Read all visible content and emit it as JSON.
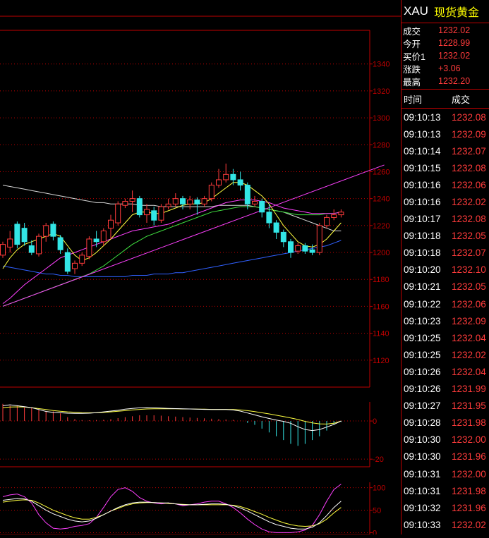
{
  "header": {
    "symbol": "XAU",
    "name": "现货黄金"
  },
  "quote": [
    {
      "label": "成交",
      "value": "1232.02"
    },
    {
      "label": "今开",
      "value": "1228.99"
    },
    {
      "label": "买价1",
      "value": "1232.02"
    },
    {
      "label": "涨跌",
      "value": "+3.06"
    },
    {
      "label": "最高",
      "value": "1232.20"
    }
  ],
  "ticks_header": {
    "time": "时间",
    "price": "成交"
  },
  "ticks": [
    {
      "time": "09:10:13",
      "price": "1232.08"
    },
    {
      "time": "09:10:13",
      "price": "1232.09"
    },
    {
      "time": "09:10:14",
      "price": "1232.07"
    },
    {
      "time": "09:10:15",
      "price": "1232.08"
    },
    {
      "time": "09:10:16",
      "price": "1232.06"
    },
    {
      "time": "09:10:16",
      "price": "1232.02"
    },
    {
      "time": "09:10:17",
      "price": "1232.08"
    },
    {
      "time": "09:10:18",
      "price": "1232.05"
    },
    {
      "time": "09:10:18",
      "price": "1232.07"
    },
    {
      "time": "09:10:20",
      "price": "1232.10"
    },
    {
      "time": "09:10:21",
      "price": "1232.05"
    },
    {
      "time": "09:10:22",
      "price": "1232.06"
    },
    {
      "time": "09:10:23",
      "price": "1232.09"
    },
    {
      "time": "09:10:25",
      "price": "1232.04"
    },
    {
      "time": "09:10:25",
      "price": "1232.02"
    },
    {
      "time": "09:10:26",
      "price": "1232.04"
    },
    {
      "time": "09:10:26",
      "price": "1231.99"
    },
    {
      "time": "09:10:27",
      "price": "1231.95"
    },
    {
      "time": "09:10:28",
      "price": "1231.98"
    },
    {
      "time": "09:10:30",
      "price": "1232.00"
    },
    {
      "time": "09:10:30",
      "price": "1231.96"
    },
    {
      "time": "09:10:31",
      "price": "1232.00"
    },
    {
      "time": "09:10:31",
      "price": "1231.98"
    },
    {
      "time": "09:10:32",
      "price": "1231.96"
    },
    {
      "time": "09:10:33",
      "price": "1232.02"
    }
  ],
  "colors": {
    "up": "#ff3b3b",
    "down": "#33e6e6",
    "grid": "#c00000",
    "ma_white": "#d8d8d8",
    "ma_yellow": "#ffff40",
    "ma_magenta": "#ff40ff",
    "ma_green": "#40e040",
    "ma_blue": "#3060ff"
  },
  "chart_data": [
    {
      "type": "candlestick",
      "ylim": [
        1100,
        1365
      ],
      "yticks": [
        1120,
        1140,
        1160,
        1180,
        1200,
        1220,
        1240,
        1260,
        1280,
        1300,
        1320,
        1340
      ],
      "candles": [
        [
          1198,
          1206,
          1196,
          1208
        ],
        [
          1204,
          1210,
          1200,
          1216
        ],
        [
          1221,
          1206,
          1203,
          1223
        ],
        [
          1218,
          1208,
          1205,
          1222
        ],
        [
          1205,
          1200,
          1198,
          1209
        ],
        [
          1199,
          1212,
          1197,
          1214
        ],
        [
          1212,
          1220,
          1208,
          1222
        ],
        [
          1221,
          1212,
          1209,
          1223
        ],
        [
          1211,
          1202,
          1199,
          1213
        ],
        [
          1200,
          1186,
          1184,
          1203
        ],
        [
          1188,
          1192,
          1184,
          1194
        ],
        [
          1192,
          1198,
          1190,
          1200
        ],
        [
          1197,
          1210,
          1195,
          1212
        ],
        [
          1210,
          1208,
          1204,
          1216
        ],
        [
          1208,
          1216,
          1205,
          1218
        ],
        [
          1218,
          1224,
          1210,
          1228
        ],
        [
          1222,
          1236,
          1220,
          1238
        ],
        [
          1235,
          1238,
          1233,
          1240
        ],
        [
          1238,
          1240,
          1230,
          1246
        ],
        [
          1240,
          1228,
          1226,
          1242
        ],
        [
          1228,
          1232,
          1222,
          1236
        ],
        [
          1231,
          1224,
          1220,
          1234
        ],
        [
          1224,
          1234,
          1222,
          1236
        ],
        [
          1234,
          1236,
          1232,
          1240
        ],
        [
          1236,
          1240,
          1234,
          1244
        ],
        [
          1240,
          1236,
          1232,
          1242
        ],
        [
          1236,
          1239,
          1232,
          1242
        ],
        [
          1239,
          1236,
          1228,
          1241
        ],
        [
          1236,
          1240,
          1234,
          1242
        ],
        [
          1240,
          1250,
          1238,
          1252
        ],
        [
          1250,
          1254,
          1248,
          1262
        ],
        [
          1254,
          1258,
          1252,
          1266
        ],
        [
          1258,
          1254,
          1250,
          1262
        ],
        [
          1254,
          1250,
          1246,
          1260
        ],
        [
          1250,
          1236,
          1232,
          1252
        ],
        [
          1236,
          1238,
          1234,
          1242
        ],
        [
          1238,
          1230,
          1226,
          1240
        ],
        [
          1230,
          1222,
          1218,
          1236
        ],
        [
          1222,
          1215,
          1210,
          1224
        ],
        [
          1215,
          1208,
          1204,
          1217
        ],
        [
          1208,
          1200,
          1196,
          1210
        ],
        [
          1201,
          1205,
          1199,
          1207
        ],
        [
          1205,
          1201,
          1199,
          1207
        ],
        [
          1202,
          1200,
          1198,
          1206
        ],
        [
          1200,
          1220,
          1198,
          1222
        ],
        [
          1220,
          1226,
          1218,
          1228
        ],
        [
          1226,
          1228,
          1224,
          1232
        ],
        [
          1228,
          1230,
          1226,
          1232
        ]
      ],
      "ma_white": [
        1250,
        1249,
        1248,
        1247,
        1246,
        1245,
        1244,
        1243,
        1242,
        1241,
        1240,
        1239,
        1238,
        1237,
        1237,
        1236,
        1236,
        1236,
        1236,
        1235,
        1235,
        1235,
        1234,
        1234,
        1234,
        1234,
        1234,
        1234,
        1234,
        1234,
        1235,
        1235,
        1235,
        1235,
        1235,
        1234,
        1233,
        1232,
        1231,
        1230,
        1228,
        1226,
        1224,
        1222,
        1220,
        1218,
        1216,
        1216
      ],
      "ma_yellow": [
        1188,
        1196,
        1202,
        1206,
        1208,
        1210,
        1212,
        1214,
        1212,
        1205,
        1198,
        1194,
        1196,
        1200,
        1205,
        1210,
        1216,
        1222,
        1228,
        1230,
        1230,
        1229,
        1229,
        1231,
        1233,
        1235,
        1236,
        1236,
        1237,
        1240,
        1244,
        1248,
        1252,
        1252,
        1250,
        1246,
        1242,
        1236,
        1228,
        1220,
        1214,
        1208,
        1205,
        1204,
        1206,
        1210,
        1216,
        1222
      ],
      "ma_magenta": [
        1162,
        1166,
        1171,
        1176,
        1180,
        1184,
        1188,
        1192,
        1196,
        1198,
        1200,
        1202,
        1204,
        1206,
        1208,
        1210,
        1212,
        1214,
        1216,
        1217,
        1218,
        1219,
        1220,
        1221,
        1223,
        1225,
        1227,
        1229,
        1231,
        1233,
        1235,
        1237,
        1238,
        1239,
        1239,
        1239,
        1238,
        1237,
        1235,
        1233,
        1232,
        1231,
        1230,
        1229,
        1229,
        1229,
        1229,
        1230
      ],
      "ma_green": [
        1160,
        1162,
        1164,
        1166,
        1168,
        1170,
        1172,
        1174,
        1176,
        1178,
        1180,
        1182,
        1184,
        1187,
        1190,
        1194,
        1198,
        1202,
        1206,
        1209,
        1212,
        1214,
        1216,
        1218,
        1220,
        1222,
        1224,
        1226,
        1228,
        1230,
        1231,
        1232,
        1233,
        1234,
        1234,
        1234,
        1233,
        1232,
        1231,
        1230,
        1229,
        1228,
        1228,
        1228,
        1228,
        1229,
        1229,
        1230
      ],
      "ma_blue": [
        1190,
        1189,
        1188,
        1187,
        1186,
        1185,
        1184,
        1184,
        1183,
        1183,
        1182,
        1182,
        1182,
        1182,
        1182,
        1182,
        1182,
        1182,
        1183,
        1183,
        1183,
        1184,
        1184,
        1184,
        1185,
        1185,
        1186,
        1187,
        1188,
        1189,
        1190,
        1191,
        1192,
        1193,
        1194,
        1195,
        1196,
        1197,
        1198,
        1199,
        1200,
        1201,
        1202,
        1203,
        1204,
        1205,
        1207,
        1209
      ],
      "trendline": [
        [
          0,
          1160
        ],
        [
          53,
          1265
        ]
      ]
    },
    {
      "type": "bar",
      "name": "MACD",
      "ylim": [
        -24,
        10
      ],
      "yticks": [
        0,
        -20
      ],
      "hist": [
        9,
        8,
        8,
        7,
        7,
        6,
        5,
        5,
        4,
        2,
        1,
        0.5,
        0.4,
        0.5,
        0.6,
        1,
        1.5,
        2,
        2.5,
        3,
        3,
        3,
        2.8,
        2.5,
        2.3,
        2,
        1.8,
        1.6,
        1.4,
        1.2,
        1,
        0.8,
        0.6,
        0.2,
        -1,
        -2,
        -4,
        -6,
        -8,
        -10,
        -12,
        -13,
        -12,
        -10,
        -8,
        -5,
        -2,
        -0.5
      ],
      "dif": [
        8,
        8.5,
        8,
        7.5,
        7,
        6,
        5,
        4.5,
        4.3,
        4.1,
        4,
        4,
        4.1,
        4.4,
        4.8,
        5.2,
        5.6,
        6.2,
        6.6,
        6.9,
        7,
        6.9,
        6.8,
        6.6,
        6.5,
        6.4,
        6.3,
        6.2,
        6.1,
        6,
        6,
        6,
        5.8,
        5.2,
        4.2,
        3.2,
        2.2,
        1.3,
        0.5,
        -0.2,
        -1.2,
        -3,
        -4.5,
        -5,
        -4.5,
        -3.2,
        -1.8,
        0
      ],
      "dea": [
        7,
        7.3,
        7.4,
        7.3,
        7,
        6.5,
        6,
        5.5,
        5.1,
        4.8,
        4.6,
        4.4,
        4.3,
        4.3,
        4.5,
        4.8,
        5.1,
        5.4,
        5.8,
        6.1,
        6.3,
        6.4,
        6.4,
        6.4,
        6.4,
        6.3,
        6.3,
        6.2,
        6.2,
        6.1,
        6.1,
        6.1,
        6,
        5.8,
        5.4,
        4.9,
        4.3,
        3.7,
        3,
        2.3,
        1.6,
        0.8,
        -0.2,
        -1,
        -1.5,
        -1.6,
        -1.2,
        0
      ]
    },
    {
      "type": "line",
      "name": "KDJ",
      "ylim": [
        -4,
        112
      ],
      "yticks": [
        100,
        50,
        0
      ],
      "k": [
        72,
        74,
        76,
        75,
        70,
        60,
        50,
        42,
        36,
        30,
        26,
        24,
        26,
        32,
        40,
        48,
        56,
        62,
        66,
        68,
        68,
        67,
        66,
        66,
        64,
        62,
        62,
        62,
        63,
        64,
        64,
        63,
        60,
        55,
        48,
        40,
        32,
        24,
        18,
        14,
        10,
        8,
        8,
        12,
        22,
        38,
        56,
        70
      ],
      "d": [
        68,
        70,
        72,
        73,
        72,
        66,
        58,
        50,
        44,
        38,
        33,
        30,
        30,
        34,
        40,
        48,
        54,
        60,
        64,
        66,
        67,
        67,
        66,
        65,
        64,
        63,
        62,
        62,
        62,
        62,
        62,
        62,
        61,
        58,
        53,
        47,
        41,
        34,
        28,
        22,
        18,
        15,
        14,
        15,
        20,
        30,
        44,
        56
      ],
      "j": [
        80,
        84,
        86,
        80,
        66,
        40,
        22,
        10,
        8,
        10,
        14,
        16,
        20,
        34,
        56,
        80,
        96,
        100,
        92,
        78,
        70,
        66,
        64,
        66,
        64,
        60,
        62,
        64,
        68,
        70,
        70,
        64,
        56,
        44,
        30,
        18,
        8,
        2,
        0,
        0,
        0,
        2,
        6,
        16,
        40,
        70,
        96,
        108
      ]
    }
  ]
}
